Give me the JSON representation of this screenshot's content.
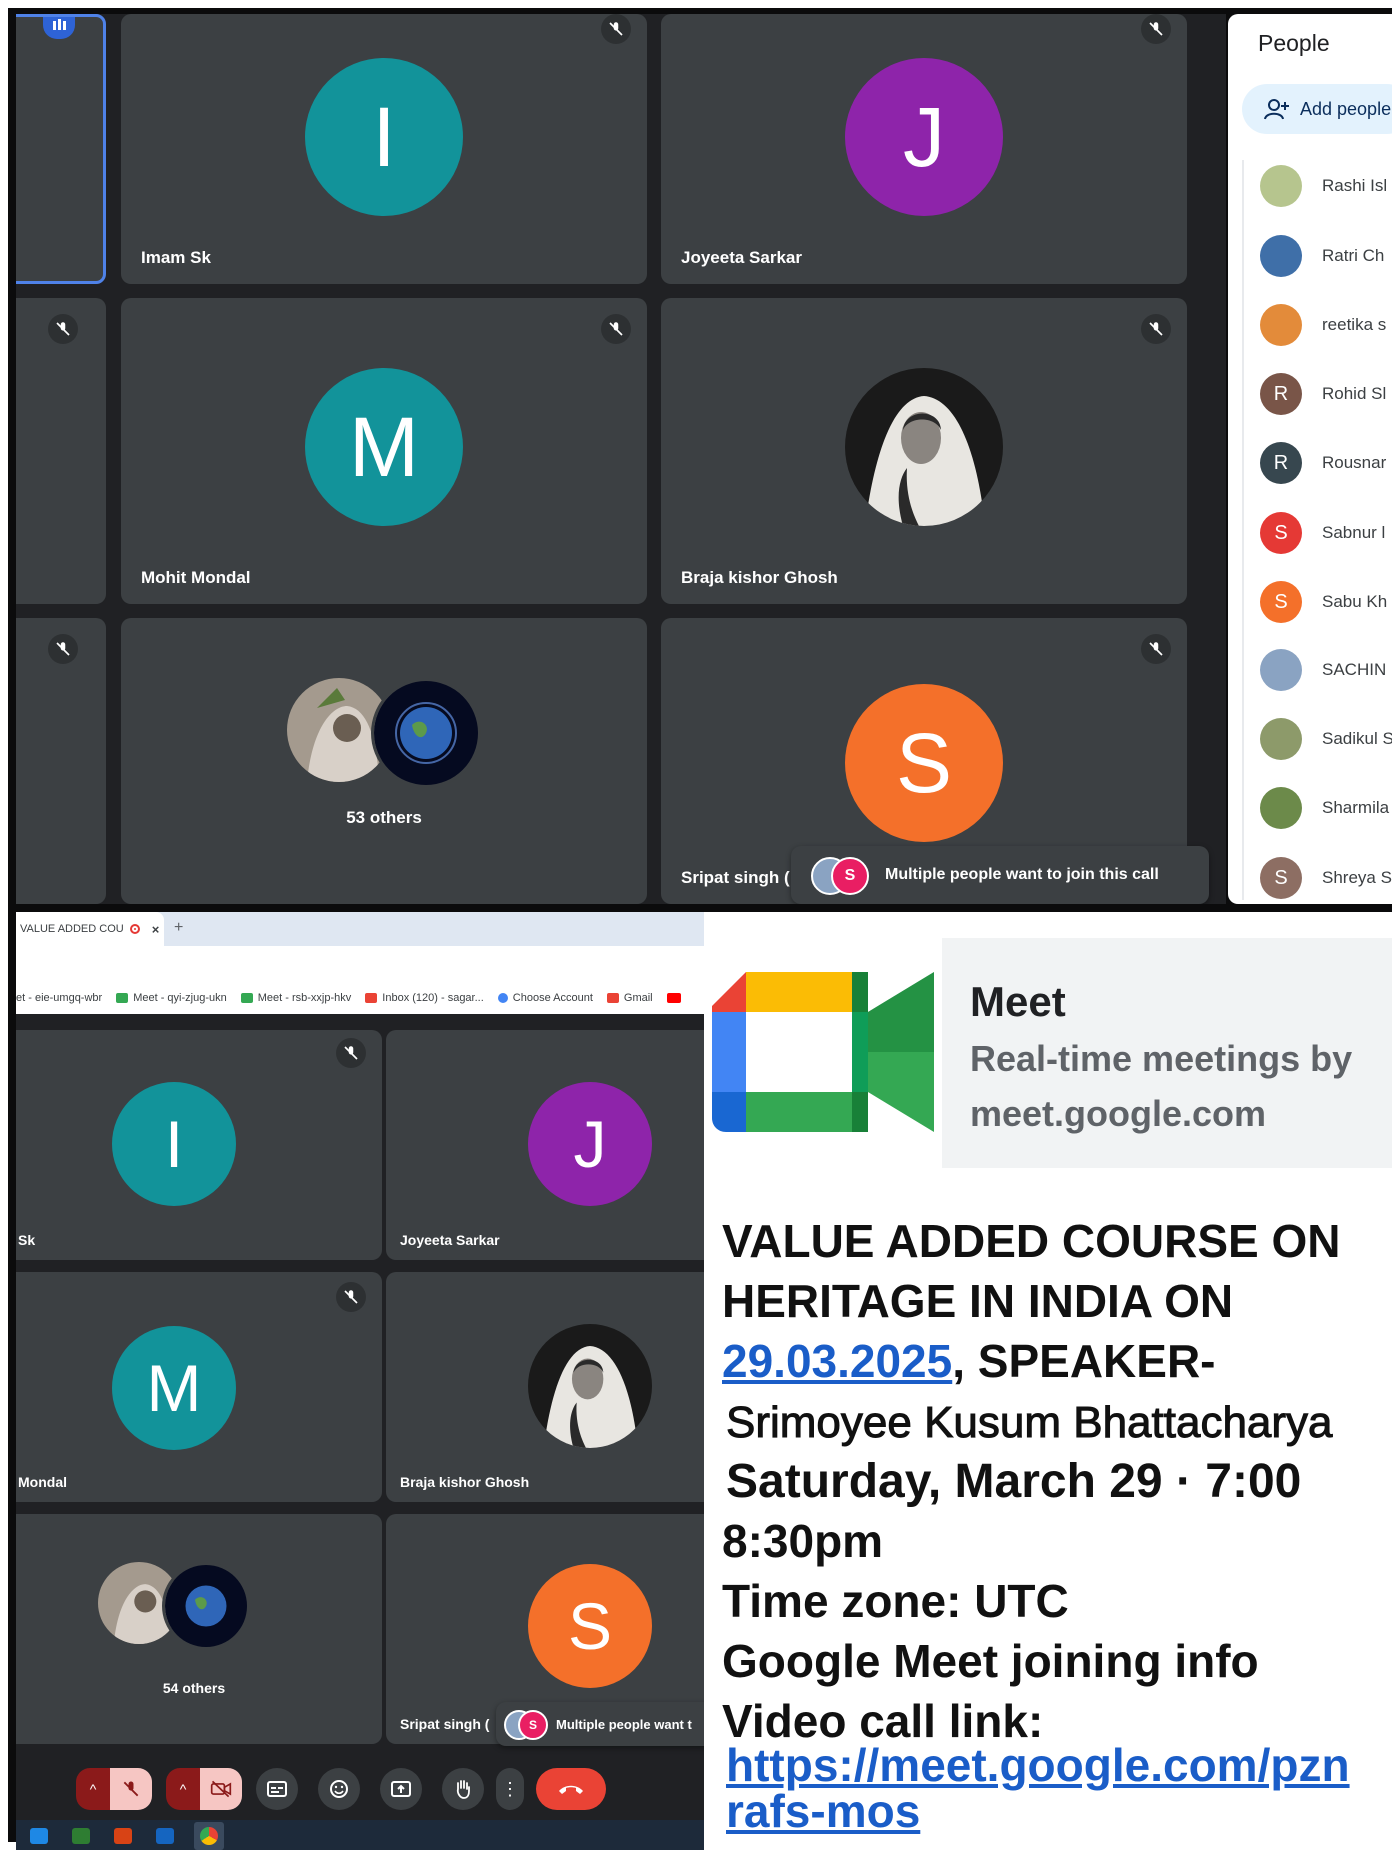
{
  "top_call": {
    "tiles": [
      {
        "name": "Imam Sk",
        "initial": "I",
        "color": "#12939a"
      },
      {
        "name": "Joyeeta Sarkar",
        "initial": "J",
        "color": "#8e24aa"
      },
      {
        "name": "Mohit Mondal",
        "initial": "M",
        "color": "#12939a"
      },
      {
        "name": "Braja kishor Ghosh",
        "initial": "",
        "color": "#e9e6df"
      },
      {
        "name": "Sripat singh (",
        "initial": "S",
        "color": "#f4702a"
      }
    ],
    "others_label": "53 others",
    "notification": {
      "text": "Multiple people want to join this call",
      "avatar_initial": "S"
    }
  },
  "people_panel": {
    "title": "People",
    "add_people_label": "Add people",
    "participants": [
      {
        "name": "Rashi Isl",
        "initial": "",
        "color": "#b6c58e",
        "is_photo": true
      },
      {
        "name": "Ratri Ch",
        "initial": "",
        "color": "#3f6fa8",
        "is_photo": true
      },
      {
        "name": "reetika s",
        "initial": "",
        "color": "#e38b3a",
        "is_photo": true
      },
      {
        "name": "Rohid Sl",
        "initial": "R",
        "color": "#795548",
        "is_photo": false
      },
      {
        "name": "Rousnar",
        "initial": "R",
        "color": "#37474f",
        "is_photo": false
      },
      {
        "name": "Sabnur l",
        "initial": "S",
        "color": "#e53935",
        "is_photo": false
      },
      {
        "name": "Sabu Kh",
        "initial": "S",
        "color": "#f4702a",
        "is_photo": false
      },
      {
        "name": "SACHIN",
        "initial": "",
        "color": "#8aa3c2",
        "is_photo": true
      },
      {
        "name": "Sadikul S",
        "initial": "",
        "color": "#8d9a6a",
        "is_photo": true
      },
      {
        "name": "Sharmila",
        "initial": "",
        "color": "#6c8a4a",
        "is_photo": true
      },
      {
        "name": "Shreya S",
        "initial": "S",
        "color": "#8d6e63",
        "is_photo": false
      }
    ]
  },
  "browser": {
    "tab_title": "VALUE ADDED COU",
    "new_tab_glyph": "+",
    "bookmarks": [
      {
        "label": "et - eie-umgq-wbr",
        "color": "#34a853"
      },
      {
        "label": "Meet - qyi-zjug-ukn",
        "color": "#34a853"
      },
      {
        "label": "Meet - rsb-xxjp-hkv",
        "color": "#34a853"
      },
      {
        "label": "Inbox (120) - sagar...",
        "color": "#ea4335"
      },
      {
        "label": "Choose Account",
        "color": "#4285f4"
      },
      {
        "label": "Gmail",
        "color": "#ea4335"
      }
    ]
  },
  "second_call": {
    "tiles": [
      {
        "name": "Sk",
        "initial": "I",
        "color": "#12939a"
      },
      {
        "name": "Joyeeta Sarkar",
        "initial": "J",
        "color": "#8e24aa"
      },
      {
        "name": "Mondal",
        "initial": "M",
        "color": "#12939a"
      },
      {
        "name": "Braja kishor Ghosh",
        "initial": "",
        "color": "#e9e6df"
      },
      {
        "name": "Sripat singh (",
        "initial": "S",
        "color": "#f4702a"
      }
    ],
    "others_label": "54 others",
    "notification": {
      "text": "Multiple people want t",
      "avatar_initial": "S"
    }
  },
  "meet_card": {
    "title": "Meet",
    "subtitle": "Real-time meetings by",
    "url": "meet.google.com"
  },
  "event": {
    "line1": "VALUE ADDED COURSE ON",
    "line2": "HERITAGE IN INDIA ON",
    "date": "29.03.2025",
    "line3_rest": ", SPEAKER-",
    "speaker": "Srimoyee Kusum Bhattacharya",
    "datetime": "Saturday, March 29 · 7:00",
    "end_time": "8:30pm",
    "timezone": "Time zone: UTC",
    "joining_info": "Google Meet joining info",
    "video_link_label": "Video call link:",
    "link_line1": "https://meet.google.com/pzn",
    "link_line2": "rafs-mos"
  },
  "colors": {
    "meet_bg": "#202124",
    "tile_bg": "#3c4043",
    "hangup": "#ea4335",
    "link": "#1a5dc8"
  }
}
